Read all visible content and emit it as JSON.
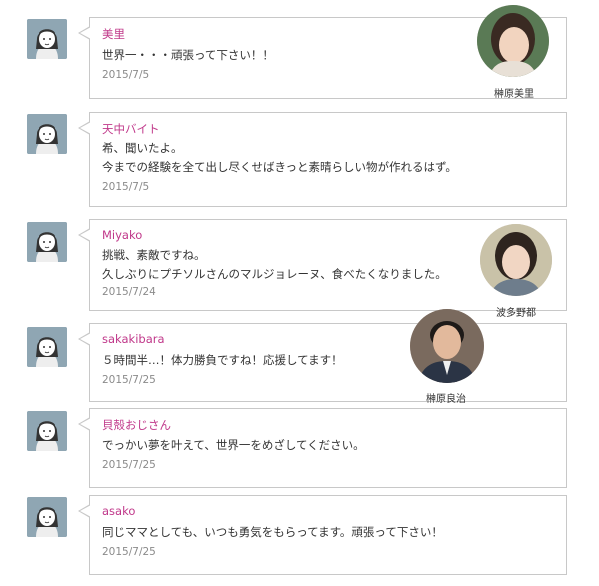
{
  "comments": [
    {
      "name": "美里",
      "lines": [
        "世界一・・・頑張って下さい！！"
      ],
      "date": "2015/7/5"
    },
    {
      "name": "天中バイト",
      "lines": [
        "希、聞いたよ。",
        "今までの経験を全て出し尽くせばきっと素晴らしい物が作れるはず。"
      ],
      "date": "2015/7/5"
    },
    {
      "name": "Miyako",
      "lines": [
        "挑戦、素敵ですね。",
        "久しぶりにプチソルさんのマルジョレーヌ、食べたくなりました。"
      ],
      "date": "2015/7/24"
    },
    {
      "name": "sakakibara",
      "lines": [
        "５時間半…！体力勝負ですね！応援してます！"
      ],
      "date": "2015/7/25"
    },
    {
      "name": "貝殻おじさん",
      "lines": [
        "でっかい夢を叶えて、世界一をめざしてください。"
      ],
      "date": "2015/7/25"
    },
    {
      "name": "asako",
      "lines": [
        "同じママとしても、いつも勇気をもらってます。頑張って下さい！"
      ],
      "date": "2015/7/25"
    }
  ],
  "photos": [
    {
      "caption": "榊原美里"
    },
    {
      "caption": "波多野都"
    },
    {
      "caption": "榊原良治"
    }
  ],
  "colors": {
    "name": "#c0388a",
    "border": "#c8c8c8",
    "avatar_bg": "#8fa6b3"
  }
}
